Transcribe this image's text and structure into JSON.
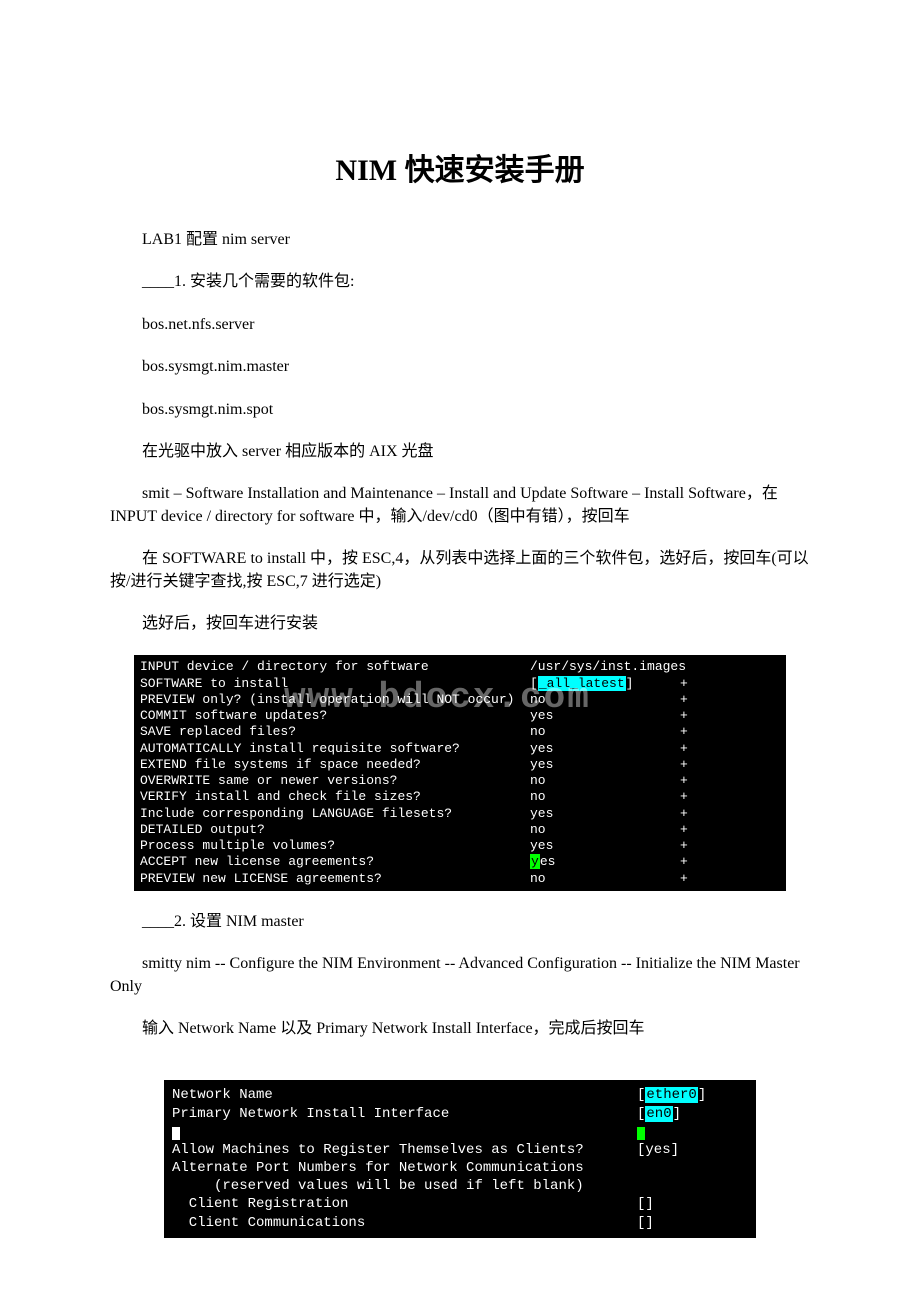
{
  "title": "NIM 快速安装手册",
  "p1": "LAB1 配置 nim server",
  "p2": "____1. 安装几个需要的软件包:",
  "p3": "bos.net.nfs.server",
  "p4": "bos.sysmgt.nim.master",
  "p5": "bos.sysmgt.nim.spot",
  "p6": "在光驱中放入 server 相应版本的 AIX 光盘",
  "p7": "smit – Software Installation and Maintenance – Install and Update Software – Install Software，在 INPUT device / directory for software 中，输入/dev/cd0（图中有错），按回车",
  "p8": "在 SOFTWARE to install 中，按 ESC,4，从列表中选择上面的三个软件包，选好后，按回车(可以按/进行关键字查找,按 ESC,7 进行选定)",
  "p9": "选好后，按回车进行安装",
  "term1": {
    "rows": [
      {
        "label": "INPUT device / directory for software",
        "val": "/usr/sys/inst.images",
        "plus": ""
      },
      {
        "label": "SOFTWARE to install",
        "val_pre": "[",
        "val_hl": "_all_latest",
        "val_post": "]",
        "plus": "+"
      },
      {
        "label": "PREVIEW only? (install operation will NOT occur)",
        "val": "no",
        "plus": "+"
      },
      {
        "label": "COMMIT software updates?",
        "val": "yes",
        "plus": "+"
      },
      {
        "label": "SAVE replaced files?",
        "val": "no",
        "plus": "+"
      },
      {
        "label": "AUTOMATICALLY install requisite software?",
        "val": "yes",
        "plus": "+"
      },
      {
        "label": "EXTEND file systems if space needed?",
        "val": "yes",
        "plus": "+"
      },
      {
        "label": "OVERWRITE same or newer versions?",
        "val": "no",
        "plus": "+"
      },
      {
        "label": "VERIFY install and check file sizes?",
        "val": "no",
        "plus": "+"
      },
      {
        "label": "Include corresponding LANGUAGE filesets?",
        "val": "yes",
        "plus": "+"
      },
      {
        "label": "DETAILED output?",
        "val": "no",
        "plus": "+"
      },
      {
        "label": "Process multiple volumes?",
        "val": "yes",
        "plus": "+"
      },
      {
        "label": "ACCEPT new license agreements?",
        "val_hl2": "y",
        "val_post2": "es",
        "plus": "+"
      },
      {
        "label": "PREVIEW new LICENSE agreements?",
        "val": "no",
        "plus": "+"
      }
    ]
  },
  "p10": "____2. 设置 NIM master",
  "p11": "smitty nim -- Configure the NIM Environment -- Advanced Configuration -- Initialize the NIM Master Only",
  "p12": "输入 Network Name 以及 Primary Network Install Interface，完成后按回车",
  "term2": {
    "r1l": "Network Name",
    "r1v_pre": "[",
    "r1v_hl": "ether0",
    "r1v_post": "]",
    "r2l": "Primary Network Install Interface",
    "r2v_pre": "[",
    "r2v_hl": "en0",
    "r2v_post": "]",
    "r3l": "Allow Machines to Register Themselves as Clients?",
    "r3v": "[yes]",
    "r4l": "Alternate Port Numbers for Network Communications",
    "r5l": "     (reserved values will be used if left blank)",
    "r6l": "  Client Registration",
    "r6v": "[]",
    "r7l": "  Client Communications",
    "r7v": "[]"
  }
}
